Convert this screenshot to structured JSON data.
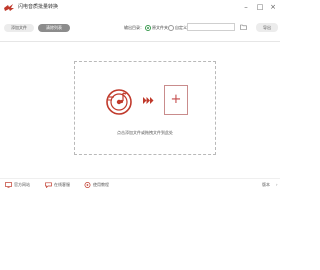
{
  "app": {
    "title": "闪电音质批量转换",
    "window_controls": [
      "minimize",
      "maximize",
      "close"
    ]
  },
  "toolbar": {
    "add_label": "添加文件",
    "clear_label": "清除列表",
    "output_dir_label": "输出目录：",
    "options": [
      "原文件夹",
      "自定义"
    ],
    "selected_option": "原文件夹",
    "path_value": "",
    "export_label": "导出"
  },
  "dropzone": {
    "hint": "点击添加文件或拖拽文件到此处"
  },
  "bottombar": {
    "items": [
      {
        "label": "官方网站",
        "icon": "monitor-icon"
      },
      {
        "label": "在线客服",
        "icon": "chat-icon"
      },
      {
        "label": "使用教程",
        "icon": "play-circle-icon"
      }
    ],
    "right_label": "版本"
  },
  "colors": {
    "accent_red": "#c0392b",
    "radio_green": "#3a9a4f",
    "clear_button_gray": "#8c8c8c"
  }
}
